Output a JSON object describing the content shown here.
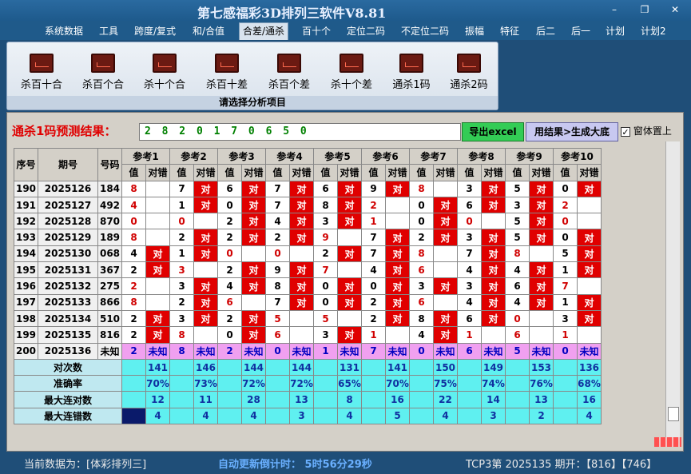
{
  "app": {
    "title": "第七感福彩3D排列三软件V8.81"
  },
  "menu": [
    "系统数据",
    "工具",
    "跨度/复式",
    "和/合值",
    "合差/通杀",
    "百十个",
    "定位二码",
    "不定位二码",
    "振幅",
    "特征",
    "后二",
    "后一",
    "计划",
    "计划2"
  ],
  "ribbon": {
    "items": [
      "杀百十合",
      "杀百个合",
      "杀十个合",
      "杀百十差",
      "杀百个差",
      "杀十个差",
      "通杀1码",
      "通杀2码"
    ],
    "caption": "请选择分析项目"
  },
  "prediction": {
    "label": "通杀1码预测结果：",
    "digits": "2 8 2 0 1 7 0 6 5 0",
    "excel_button": "导出excel",
    "generate_button": "用结果>生成大底",
    "topmost_label": "窗体置上"
  },
  "table": {
    "headers": {
      "index": "序号",
      "period": "期号",
      "number": "号码",
      "value": "值",
      "check": "对错"
    },
    "refs": [
      "参考1",
      "参考2",
      "参考3",
      "参考4",
      "参考5",
      "参考6",
      "参考7",
      "参考8",
      "参考9",
      "参考10"
    ],
    "rows": [
      {
        "idx": "190",
        "period": "2025126",
        "num": "184",
        "vals": [
          "8",
          "7",
          "6",
          "7",
          "6",
          "9",
          "8",
          "3",
          "5",
          "0"
        ],
        "hits": [
          0,
          1,
          1,
          1,
          1,
          1,
          0,
          1,
          1,
          1
        ]
      },
      {
        "idx": "191",
        "period": "2025127",
        "num": "492",
        "vals": [
          "4",
          "1",
          "0",
          "7",
          "8",
          "2",
          "0",
          "6",
          "3",
          "2"
        ],
        "hits": [
          0,
          1,
          1,
          1,
          1,
          0,
          1,
          1,
          1,
          0
        ]
      },
      {
        "idx": "192",
        "period": "2025128",
        "num": "870",
        "vals": [
          "0",
          "0",
          "2",
          "4",
          "3",
          "1",
          "0",
          "0",
          "5",
          "0"
        ],
        "hits": [
          0,
          0,
          1,
          1,
          1,
          0,
          1,
          0,
          1,
          0
        ]
      },
      {
        "idx": "193",
        "period": "2025129",
        "num": "189",
        "vals": [
          "8",
          "2",
          "2",
          "2",
          "9",
          "7",
          "2",
          "3",
          "5",
          "0"
        ],
        "hits": [
          0,
          1,
          1,
          1,
          0,
          1,
          1,
          1,
          1,
          1
        ]
      },
      {
        "idx": "194",
        "period": "2025130",
        "num": "068",
        "vals": [
          "4",
          "1",
          "0",
          "0",
          "2",
          "7",
          "8",
          "7",
          "8",
          "5"
        ],
        "hits": [
          1,
          1,
          0,
          0,
          1,
          1,
          0,
          1,
          0,
          1
        ]
      },
      {
        "idx": "195",
        "period": "2025131",
        "num": "367",
        "vals": [
          "2",
          "3",
          "2",
          "9",
          "7",
          "4",
          "6",
          "4",
          "4",
          "1"
        ],
        "hits": [
          1,
          0,
          1,
          1,
          0,
          1,
          0,
          1,
          1,
          1
        ]
      },
      {
        "idx": "196",
        "period": "2025132",
        "num": "275",
        "vals": [
          "2",
          "3",
          "4",
          "8",
          "0",
          "0",
          "3",
          "3",
          "6",
          "7"
        ],
        "hits": [
          0,
          1,
          1,
          1,
          1,
          1,
          1,
          1,
          1,
          0
        ]
      },
      {
        "idx": "197",
        "period": "2025133",
        "num": "866",
        "vals": [
          "8",
          "2",
          "6",
          "7",
          "0",
          "2",
          "6",
          "4",
          "4",
          "1"
        ],
        "hits": [
          0,
          1,
          0,
          1,
          1,
          1,
          0,
          1,
          1,
          1
        ]
      },
      {
        "idx": "198",
        "period": "2025134",
        "num": "510",
        "vals": [
          "2",
          "3",
          "2",
          "5",
          "5",
          "2",
          "8",
          "6",
          "0",
          "3"
        ],
        "hits": [
          1,
          1,
          1,
          0,
          0,
          1,
          1,
          1,
          0,
          1
        ]
      },
      {
        "idx": "199",
        "period": "2025135",
        "num": "816",
        "vals": [
          "2",
          "8",
          "0",
          "6",
          "3",
          "1",
          "4",
          "1",
          "6",
          "1"
        ],
        "hits": [
          1,
          0,
          1,
          0,
          1,
          0,
          1,
          0,
          0,
          0
        ]
      }
    ],
    "pending": {
      "idx": "200",
      "period": "2025136",
      "num": "未知",
      "vals": [
        "2",
        "8",
        "2",
        "0",
        "1",
        "7",
        "0",
        "6",
        "5",
        "0"
      ],
      "unknown": "未知"
    },
    "stats": [
      {
        "label": "对次数",
        "values": [
          "141",
          "146",
          "144",
          "144",
          "131",
          "141",
          "150",
          "149",
          "153",
          "136"
        ]
      },
      {
        "label": "准确率",
        "values": [
          "70%",
          "73%",
          "72%",
          "72%",
          "65%",
          "70%",
          "75%",
          "74%",
          "76%",
          "68%"
        ]
      },
      {
        "label": "最大连对数",
        "values": [
          "12",
          "11",
          "28",
          "13",
          "8",
          "16",
          "22",
          "14",
          "13",
          "16"
        ]
      },
      {
        "label": "最大连错数",
        "values": [
          "4",
          "4",
          "4",
          "3",
          "4",
          "5",
          "4",
          "3",
          "2",
          "4"
        ]
      }
    ]
  },
  "status": {
    "source": "当前数据为：[体彩排列三]",
    "countdown": "自动更新倒计时：  5时56分29秒",
    "lottery": "TCP3第 2025135 期开：【816】【746】"
  },
  "colors": {
    "hit": "#e00000",
    "stats_value": "#5ff0f0",
    "pending_row": "#f0a0f0"
  }
}
